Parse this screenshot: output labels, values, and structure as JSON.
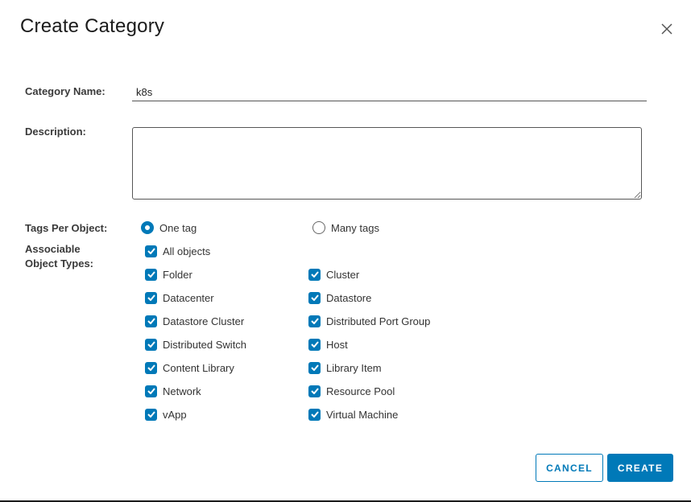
{
  "dialog": {
    "title": "Create Category",
    "close_icon": "close-icon"
  },
  "form": {
    "category_name": {
      "label": "Category Name:",
      "value": "k8s"
    },
    "description": {
      "label": "Description:",
      "value": ""
    },
    "tags_per_object": {
      "label": "Tags Per Object:",
      "options": [
        {
          "label": "One tag",
          "checked": true
        },
        {
          "label": "Many tags",
          "checked": false
        }
      ]
    },
    "associable_types": {
      "label_line1": "Associable",
      "label_line2": "Object Types:",
      "all_objects": {
        "label": "All objects",
        "checked": true
      },
      "left_column": [
        {
          "label": "Folder",
          "checked": true
        },
        {
          "label": "Datacenter",
          "checked": true
        },
        {
          "label": "Datastore Cluster",
          "checked": true
        },
        {
          "label": "Distributed Switch",
          "checked": true
        },
        {
          "label": "Content Library",
          "checked": true
        },
        {
          "label": "Network",
          "checked": true
        },
        {
          "label": "vApp",
          "checked": true
        }
      ],
      "right_column": [
        {
          "label": "Cluster",
          "checked": true
        },
        {
          "label": "Datastore",
          "checked": true
        },
        {
          "label": "Distributed Port Group",
          "checked": true
        },
        {
          "label": "Host",
          "checked": true
        },
        {
          "label": "Library Item",
          "checked": true
        },
        {
          "label": "Resource Pool",
          "checked": true
        },
        {
          "label": "Virtual Machine",
          "checked": true
        }
      ]
    }
  },
  "footer": {
    "cancel_label": "CANCEL",
    "create_label": "CREATE"
  },
  "colors": {
    "accent": "#0079b8"
  }
}
